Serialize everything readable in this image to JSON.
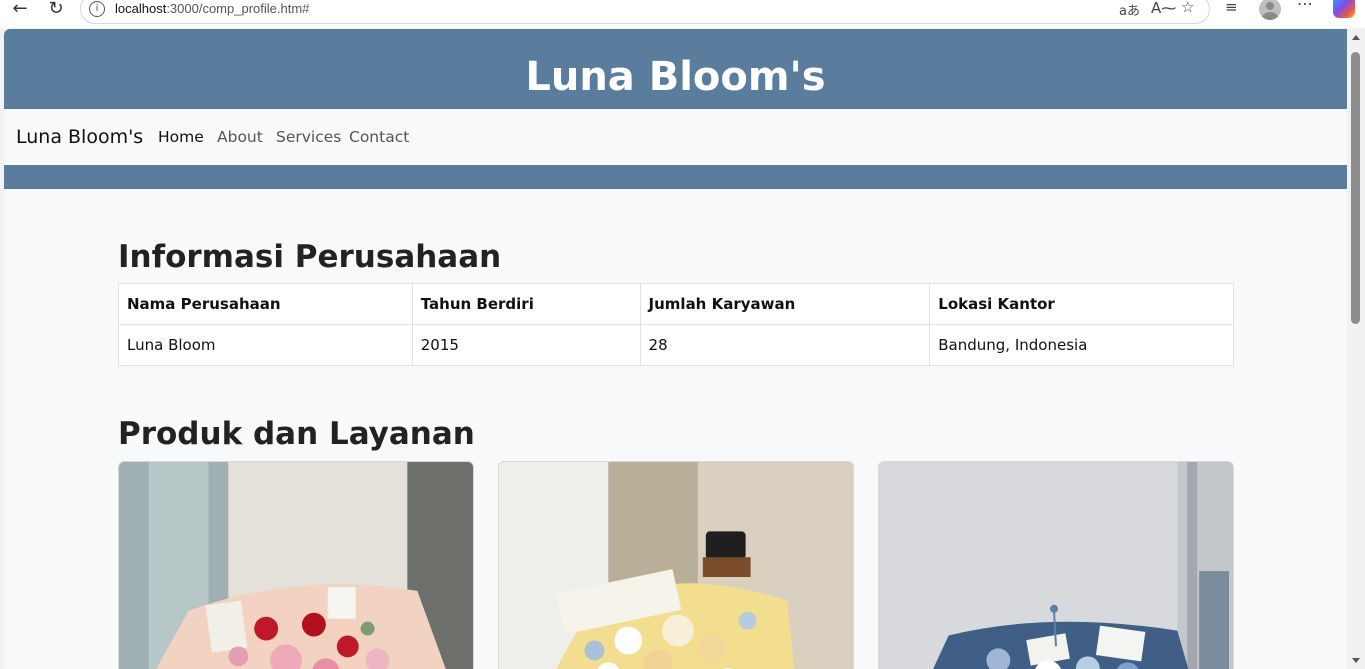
{
  "browser": {
    "url_host": "localhost",
    "url_path": ":3000/comp_profile.htm#"
  },
  "hero": {
    "title": "Luna Bloom's"
  },
  "navbar": {
    "brand": "Luna Bloom's",
    "links": [
      "Home",
      "About",
      "Services",
      "Contact"
    ]
  },
  "company": {
    "title": "Informasi Perusahaan",
    "headers": [
      "Nama Perusahaan",
      "Tahun Berdiri",
      "Jumlah Karyawan",
      "Lokasi Kantor"
    ],
    "row": [
      "Luna Bloom",
      "2015",
      "28",
      "Bandung, Indonesia"
    ]
  },
  "products": {
    "title": "Produk dan Layanan"
  },
  "colors": {
    "accent": "#5a7d9e",
    "page_bg": "#f8f9fa"
  }
}
